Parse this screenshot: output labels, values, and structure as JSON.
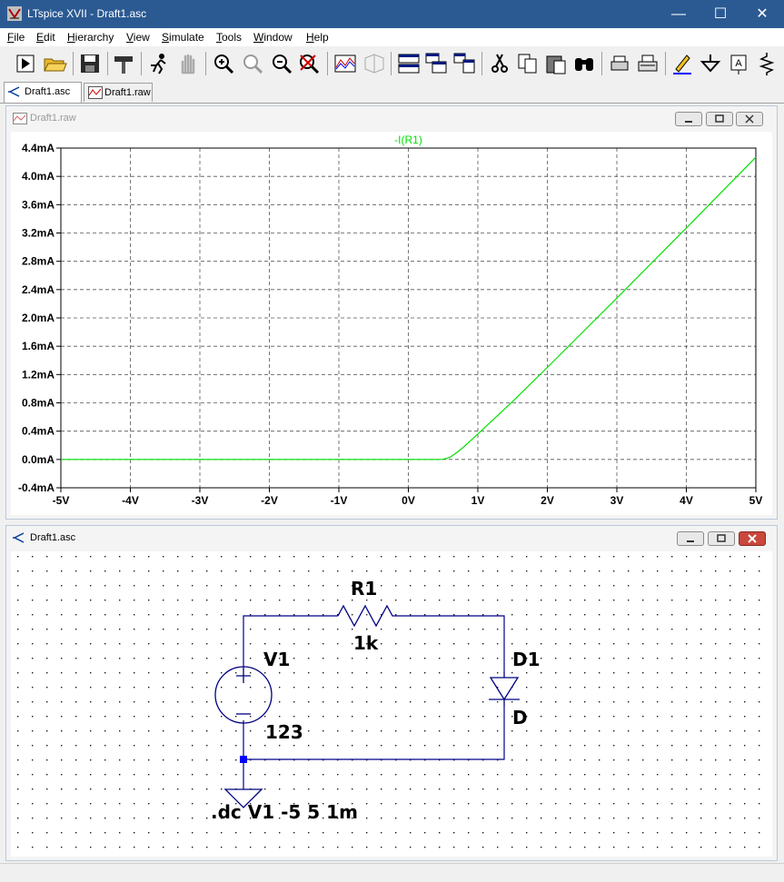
{
  "window": {
    "title": "LTspice XVII - Draft1.asc"
  },
  "menu": [
    {
      "label": "File",
      "u": "F",
      "rest": "ile"
    },
    {
      "label": "Edit",
      "u": "E",
      "rest": "dit"
    },
    {
      "label": "Hierarchy",
      "u": "H",
      "rest": "ierarchy"
    },
    {
      "label": "View",
      "u": "V",
      "rest": "iew"
    },
    {
      "label": "Simulate",
      "u": "S",
      "rest": "imulate"
    },
    {
      "label": "Tools",
      "u": "T",
      "rest": "ools"
    },
    {
      "label": "Window",
      "u": "W",
      "rest": "indow"
    },
    {
      "label": "Help",
      "u": "H",
      "rest": "elp"
    }
  ],
  "tabs": [
    {
      "label": "Draft1.asc",
      "icon": "schematic-icon",
      "active": true
    },
    {
      "label": "Draft1.raw",
      "icon": "waveform-icon",
      "active": false
    }
  ],
  "plot_window": {
    "title": "Draft1.raw"
  },
  "schematic_window": {
    "title": "Draft1.asc"
  },
  "chart_data": {
    "type": "line",
    "title": "-I(R1)",
    "xlim": [
      -5,
      5
    ],
    "ylim": [
      -0.4,
      4.4
    ],
    "x_ticks": [
      "-5V",
      "-4V",
      "-3V",
      "-2V",
      "-1V",
      "0V",
      "1V",
      "2V",
      "3V",
      "4V",
      "5V"
    ],
    "y_ticks": [
      "-0.4mA",
      "0.0mA",
      "0.4mA",
      "0.8mA",
      "1.2mA",
      "1.6mA",
      "2.0mA",
      "2.4mA",
      "2.8mA",
      "3.2mA",
      "3.6mA",
      "4.0mA",
      "4.4mA"
    ],
    "grid": true,
    "series": [
      {
        "name": "-I(R1)",
        "color": "#00e000",
        "x": [
          -5,
          0,
          0.4,
          0.5,
          0.6,
          0.7,
          0.8,
          1.0,
          1.5,
          2.0,
          3.0,
          4.0,
          5.0
        ],
        "y": [
          0,
          0,
          0,
          0.002,
          0.03,
          0.1,
          0.18,
          0.36,
          0.82,
          1.3,
          2.28,
          3.27,
          4.27
        ]
      }
    ]
  },
  "schematic": {
    "resistor": {
      "name": "R1",
      "value": "1k"
    },
    "source": {
      "name": "V1",
      "value": "123"
    },
    "diode": {
      "name": "D1",
      "value": "D"
    },
    "directive": ".dc V1 -5 5 1m",
    "wire_color": "#00008b",
    "component_color": "#000080"
  }
}
